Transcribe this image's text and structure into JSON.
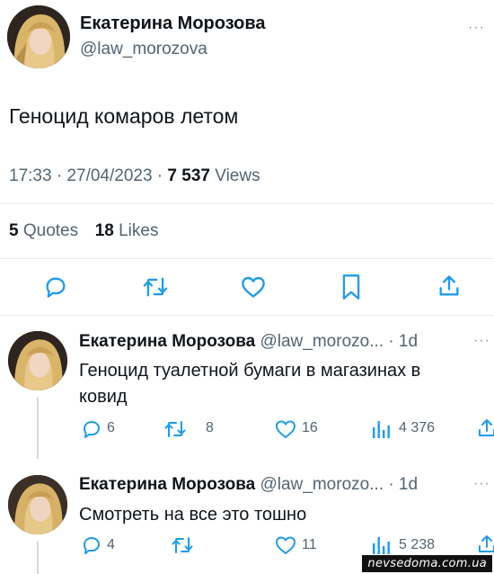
{
  "main_tweet": {
    "author_name": "Екатерина Морозова",
    "author_handle": "@law_morozova",
    "text": "Геноцид комаров летом",
    "time": "17:33 · 27/04/2023 · ",
    "views_count": "7 537",
    "views_label": " Views",
    "quotes_count": "5",
    "quotes_label": " Quotes",
    "likes_count": "18",
    "likes_label": " Likes"
  },
  "replies": [
    {
      "author_name": "Екатерина Морозова",
      "author_handle": "@law_morozo...",
      "age": "· 1d",
      "text": "Геноцид туалетной бумаги в магазинах в ковид",
      "replies": "6",
      "retweets": "8",
      "likes": "16",
      "views": "4 376"
    },
    {
      "author_name": "Екатерина Морозова",
      "author_handle": "@law_morozo...",
      "age": "· 1d",
      "text": "Смотреть на все это тошно",
      "replies": "4",
      "retweets": "",
      "likes": "11",
      "views": "5 238"
    }
  ],
  "more_icon_text": "···",
  "watermark": "nevsedoma.com.ua",
  "colors": {
    "text": "#0f1419",
    "muted": "#536471",
    "divider": "#e6ecf0",
    "icon": "#536471",
    "action_icon": "#1d9bf0"
  },
  "icons": [
    "reply-icon",
    "retweet-icon",
    "like-icon",
    "bookmark-icon",
    "share-icon",
    "views-icon",
    "more-icon"
  ]
}
